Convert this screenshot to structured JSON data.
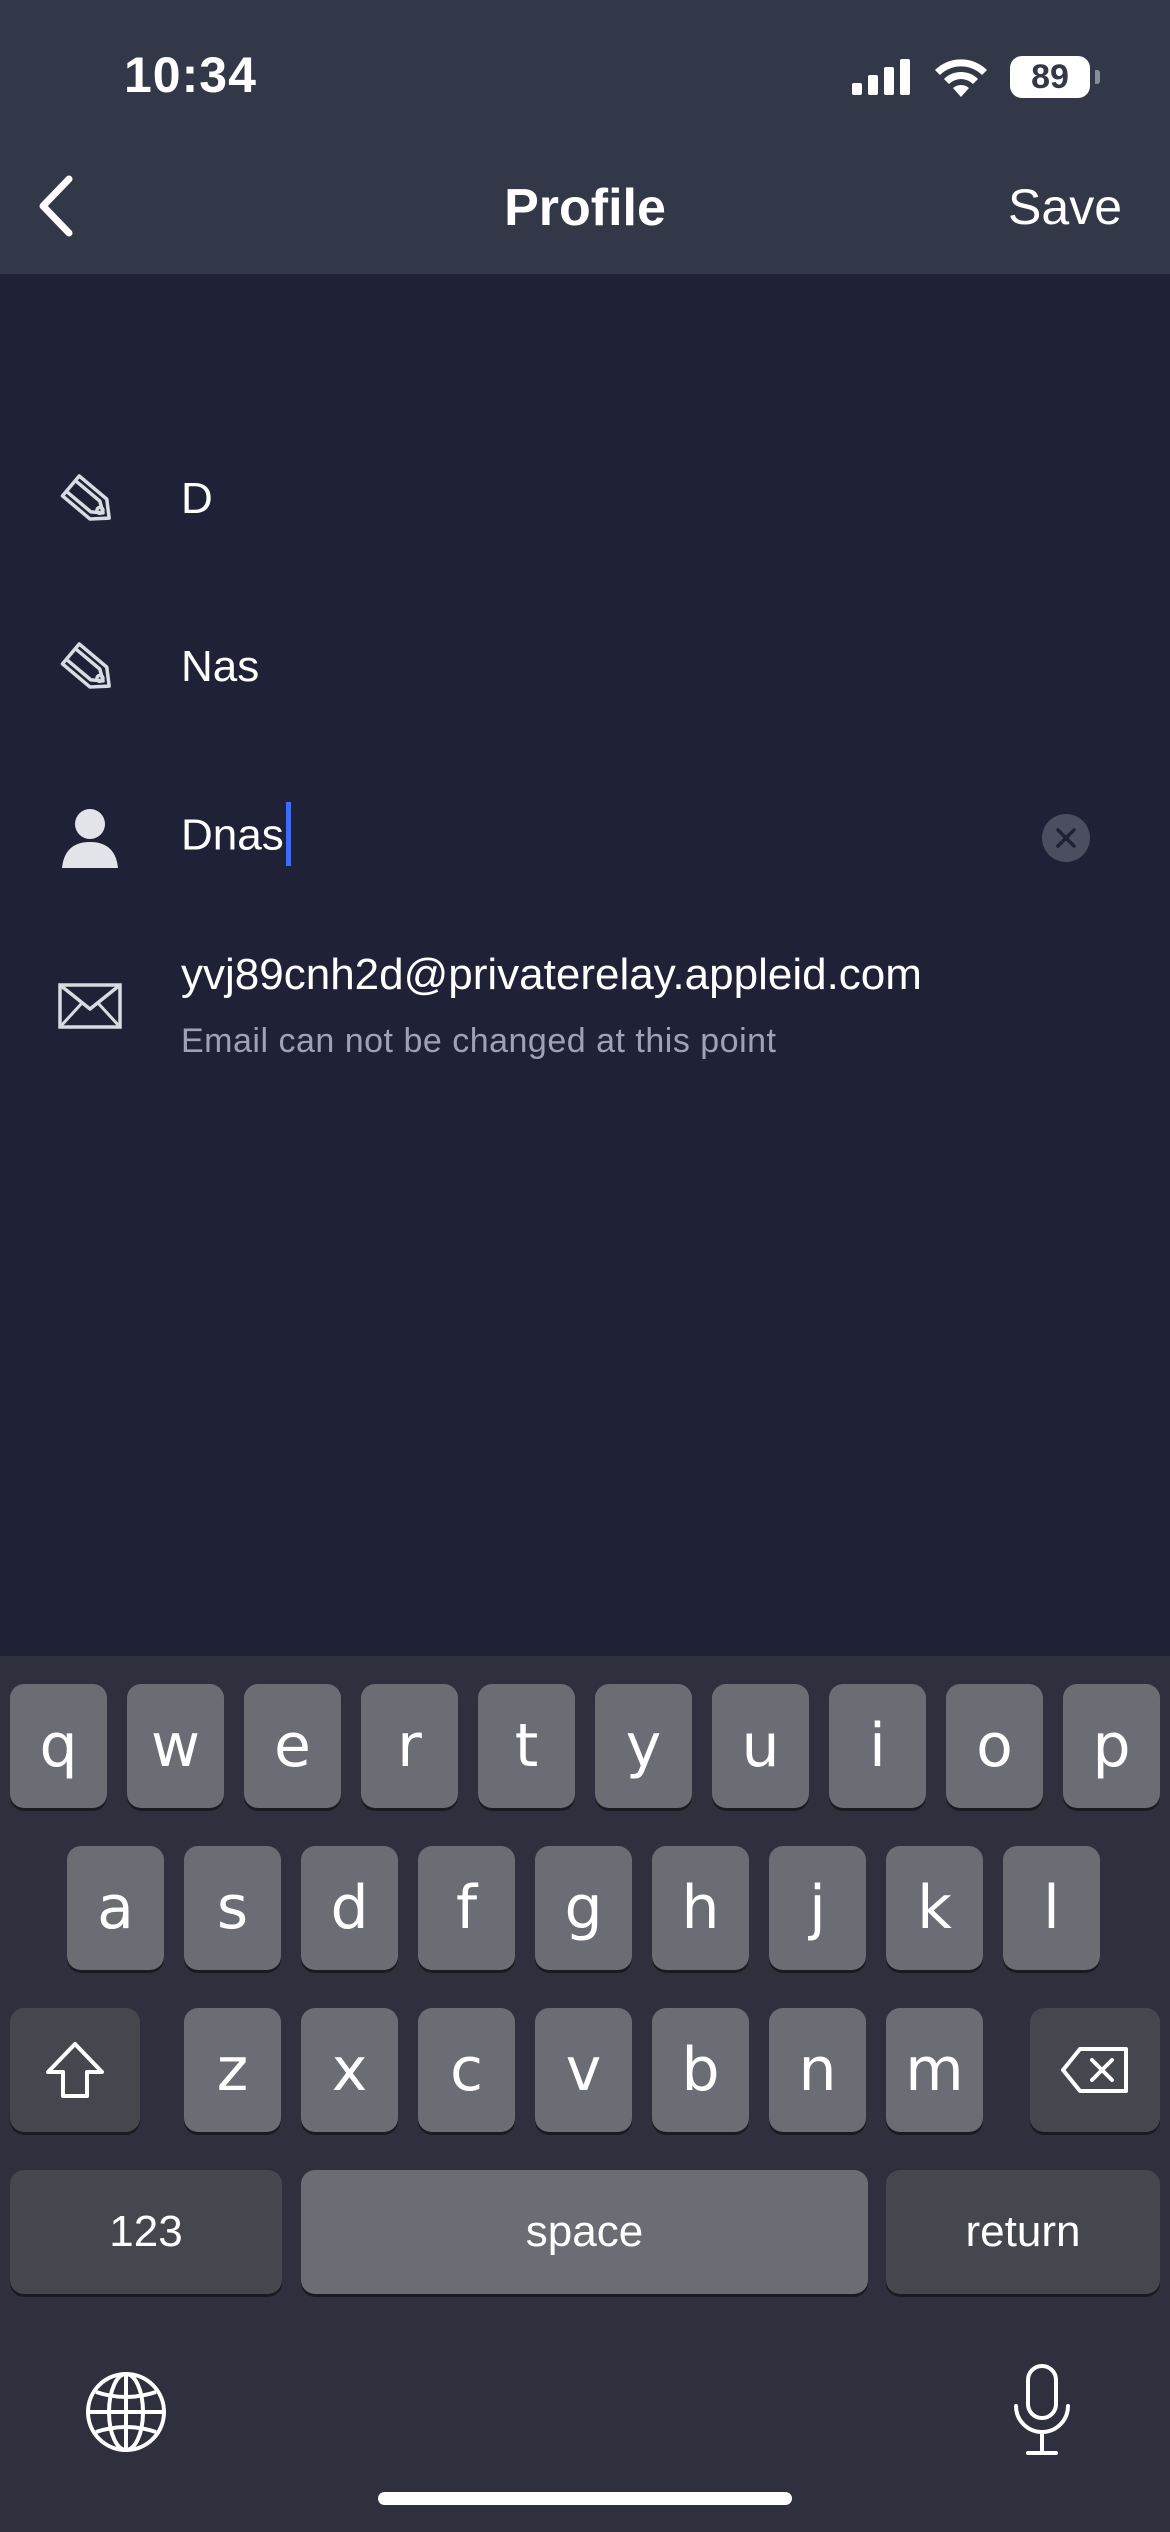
{
  "status_bar": {
    "time": "10:34",
    "battery": "89"
  },
  "nav": {
    "title": "Profile",
    "save_label": "Save"
  },
  "fields": [
    {
      "icon": "tag-icon",
      "value": "D"
    },
    {
      "icon": "tag-icon",
      "value": "Nas"
    },
    {
      "icon": "person-icon",
      "value": "Dnas"
    },
    {
      "icon": "envelope-icon",
      "value": "yvj89cnh2d@privaterelay.appleid.com",
      "note": "Email can not be changed at this point"
    }
  ],
  "keyboard": {
    "row1": [
      "q",
      "w",
      "e",
      "r",
      "t",
      "y",
      "u",
      "i",
      "o",
      "p"
    ],
    "row2": [
      "a",
      "s",
      "d",
      "f",
      "g",
      "h",
      "j",
      "k",
      "l"
    ],
    "row3": [
      "z",
      "x",
      "c",
      "v",
      "b",
      "n",
      "m"
    ],
    "numbers_label": "123",
    "space_label": "space",
    "return_label": "return"
  },
  "colors": {
    "background": "#1f2237",
    "header": "#333849",
    "caret": "#3f6cf5",
    "keyboard": "#2e303d"
  }
}
